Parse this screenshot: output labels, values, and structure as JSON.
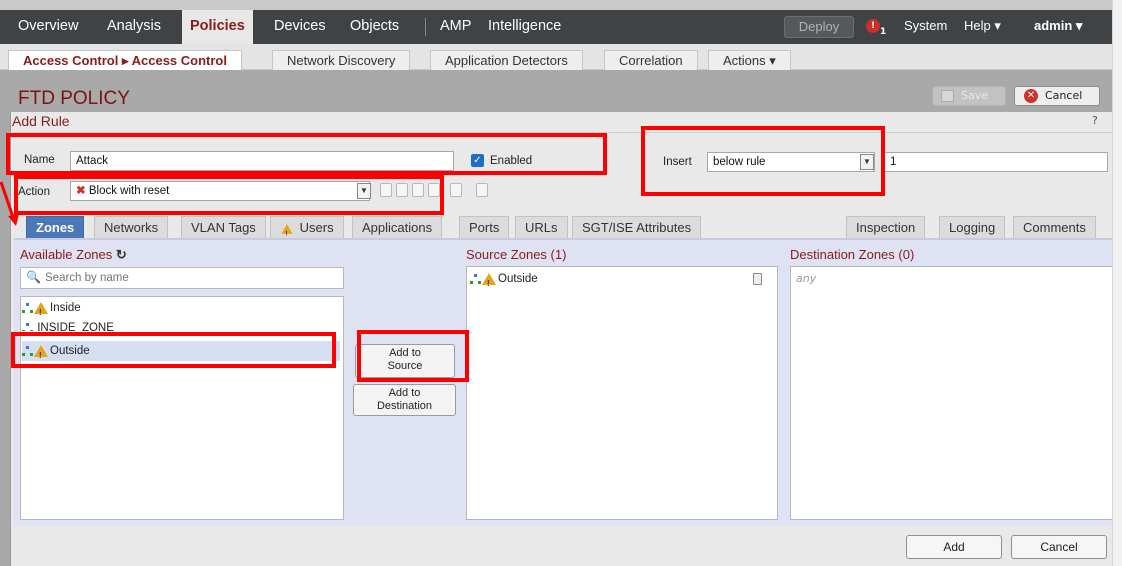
{
  "nav": {
    "items": [
      "Overview",
      "Analysis",
      "Policies",
      "Devices",
      "Objects",
      "AMP",
      "Intelligence"
    ],
    "active": "Policies",
    "deploy": "Deploy",
    "alert_count": "1",
    "system": "System",
    "help": "Help",
    "user": "admin"
  },
  "subnav": {
    "items": [
      "Access Control ▸ Access Control",
      "Network Discovery",
      "Application Detectors",
      "Correlation",
      "Actions"
    ],
    "active": "Access Control ▸ Access Control"
  },
  "policy": {
    "title": "FTD POLICY",
    "save": "Save",
    "cancel": "Cancel"
  },
  "dialog": {
    "title": "Add Rule",
    "help": "?",
    "name_label": "Name",
    "name_value": "Attack",
    "enabled_label": "Enabled",
    "enabled": true,
    "insert_label": "Insert",
    "insert_value": "below rule",
    "insert_number": "1",
    "action_label": "Action",
    "action_value": "Block with reset"
  },
  "tabs": {
    "left": [
      "Zones",
      "Networks",
      "VLAN Tags",
      "Users",
      "Applications",
      "Ports",
      "URLs",
      "SGT/ISE Attributes"
    ],
    "right": [
      "Inspection",
      "Logging",
      "Comments"
    ],
    "active": "Zones"
  },
  "zones": {
    "available_heading": "Available Zones",
    "search_placeholder": "Search by name",
    "available": [
      "Inside",
      "INSIDE_ZONE",
      "Outside"
    ],
    "selected": "Outside",
    "add_to_source": "Add to\nSource",
    "add_to_destination": "Add to\nDestination",
    "source_heading": "Source Zones (1)",
    "source": [
      "Outside"
    ],
    "destination_heading": "Destination Zones (0)",
    "destination_placeholder": "any"
  },
  "footer": {
    "add": "Add",
    "cancel": "Cancel"
  },
  "colors": {
    "nav_bg": "#3f4346",
    "accent_red": "#8b1a1a",
    "tab_active": "#4a78b8",
    "annotation": "#ff0000"
  }
}
